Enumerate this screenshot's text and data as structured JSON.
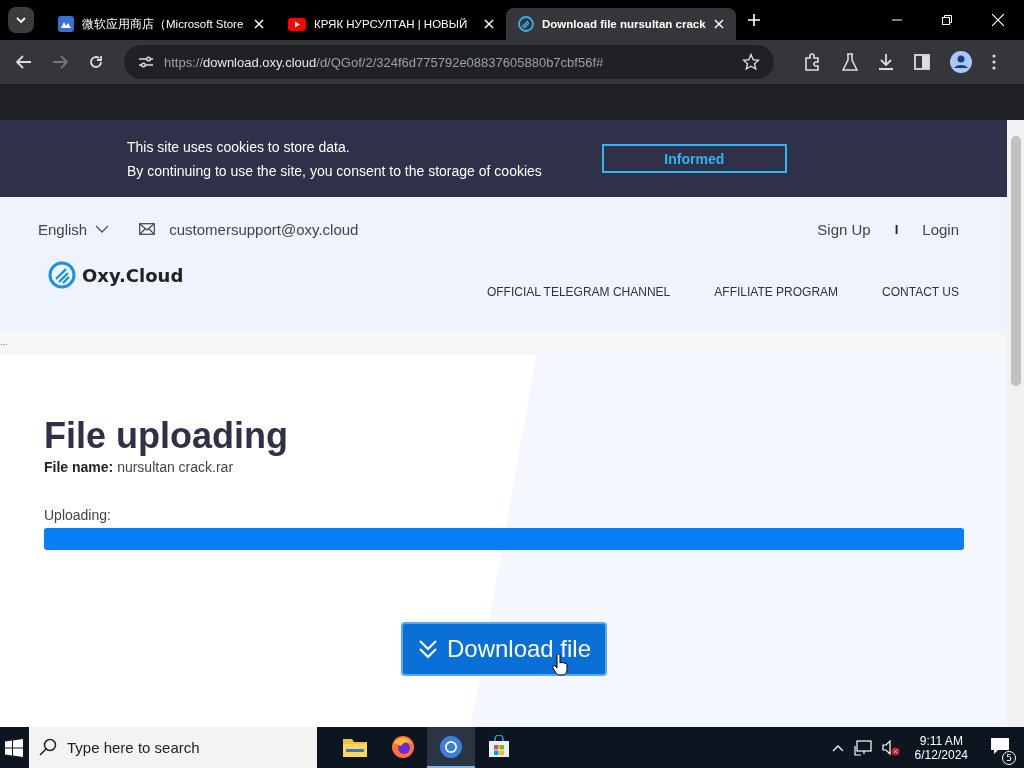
{
  "browser": {
    "tabs": [
      {
        "title": "微软应用商店（Microsoft Store",
        "kind": "store",
        "selected": false
      },
      {
        "title": "КРЯК НУРСУЛТАН | НОВЫЙ",
        "kind": "video",
        "selected": false
      },
      {
        "title": "Download file nursultan crack",
        "kind": "cloud",
        "selected": true
      }
    ],
    "url_prefix": "https://",
    "url_host": "download.oxy.cloud",
    "url_path": "/d/QGof/2/324f6d775792e08837605880b7cbf56f#"
  },
  "cookie_banner": {
    "lines": [
      "This site uses cookies to store data.",
      "By continuing to use the site, you consent to the storage of cookies"
    ],
    "button": "Informed"
  },
  "header": {
    "language": "English",
    "email": "customersupport@oxy.cloud",
    "sign_up": "Sign Up",
    "separator": "I",
    "login": "Login",
    "logo": "Oxy.Cloud",
    "nav": [
      "OFFICIAL TELEGRAM CHANNEL",
      "AFFILIATE PROGRAM",
      "CONTACT US"
    ]
  },
  "strip_text": "...",
  "main": {
    "title": "File uploading",
    "file_label": "File name:",
    "file_name": "nursultan crack.rar",
    "progress_label": "Uploading:",
    "level": 1,
    "button": "Download file"
  },
  "taskbar": {
    "search_placeholder": "Type here to search",
    "apps": [
      {
        "kind": "folder",
        "selected": false
      },
      {
        "kind": "firefox",
        "selected": false
      },
      {
        "kind": "chrome",
        "selected": true
      },
      {
        "kind": "store",
        "selected": false
      }
    ],
    "time": "9:11 AM",
    "date": "6/12/2024",
    "notifications": "5"
  }
}
